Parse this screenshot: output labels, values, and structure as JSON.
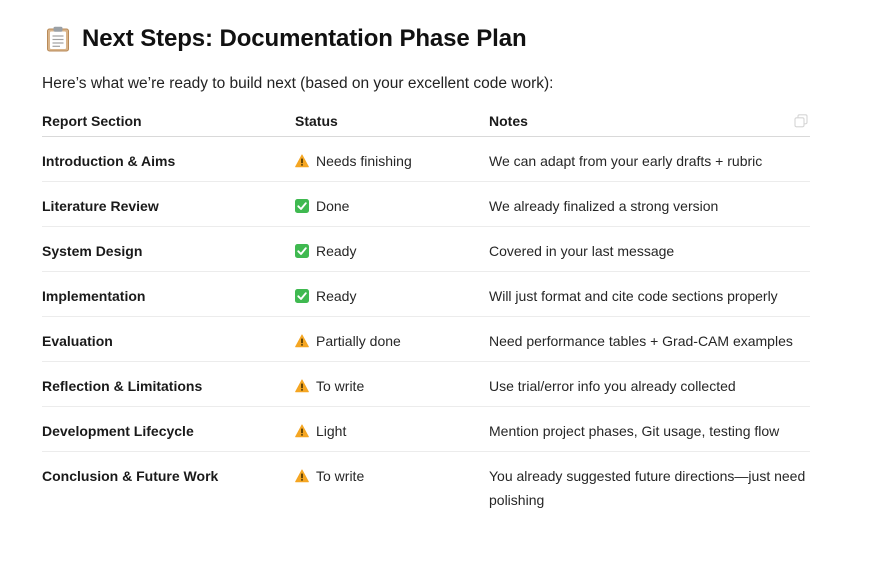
{
  "heading": {
    "icon": "clipboard-icon",
    "title": "Next Steps: Documentation Phase Plan"
  },
  "intro": "Here’s what we’re ready to build next (based on your excellent code work):",
  "table": {
    "headers": [
      "Report Section",
      "Status",
      "Notes"
    ],
    "rows": [
      {
        "section": "Introduction & Aims",
        "status_icon": "warning-icon",
        "status": "Needs finishing",
        "notes": "We can adapt from your early drafts + rubric"
      },
      {
        "section": "Literature Review",
        "status_icon": "check-icon",
        "status": "Done",
        "notes": "We already finalized a strong version"
      },
      {
        "section": "System Design",
        "status_icon": "check-icon",
        "status": "Ready",
        "notes": "Covered in your last message"
      },
      {
        "section": "Implementation",
        "status_icon": "check-icon",
        "status": "Ready",
        "notes": "Will just format and cite code sections properly"
      },
      {
        "section": "Evaluation",
        "status_icon": "warning-icon",
        "status": "Partially done",
        "notes": "Need performance tables + Grad-CAM examples"
      },
      {
        "section": "Reflection & Limitations",
        "status_icon": "warning-icon",
        "status": "To write",
        "notes": "Use trial/error info you already collected"
      },
      {
        "section": "Development Lifecycle",
        "status_icon": "warning-icon",
        "status": "Light",
        "notes": "Mention project phases, Git usage, testing flow"
      },
      {
        "section": "Conclusion & Future Work",
        "status_icon": "warning-icon",
        "status": "To write",
        "notes": "You already suggested future directions—just need polishing"
      }
    ]
  },
  "colors": {
    "warning": "#f5a623",
    "check": "#3fb950",
    "text": "#1f1f1f"
  }
}
